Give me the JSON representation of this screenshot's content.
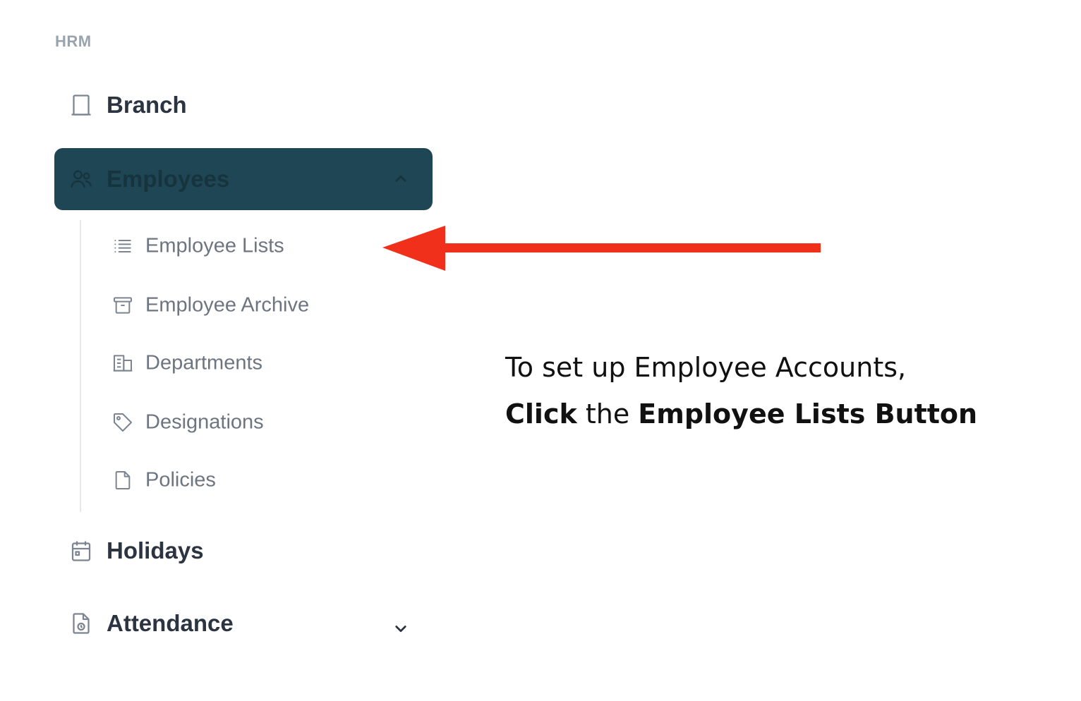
{
  "sidebar": {
    "section_label": "HRM",
    "items": [
      {
        "label": "Branch",
        "icon": "building-icon"
      },
      {
        "label": "Employees",
        "icon": "users-icon",
        "expanded": true
      },
      {
        "label": "Holidays",
        "icon": "calendar-icon"
      },
      {
        "label": "Attendance",
        "icon": "file-clock-icon",
        "expanded": false
      }
    ],
    "employees_submenu": [
      {
        "label": "Employee Lists",
        "icon": "list-icon"
      },
      {
        "label": "Employee Archive",
        "icon": "archive-icon"
      },
      {
        "label": "Departments",
        "icon": "buildings-icon"
      },
      {
        "label": "Designations",
        "icon": "tag-icon"
      },
      {
        "label": "Policies",
        "icon": "document-icon"
      }
    ]
  },
  "annotation": {
    "line1": "To set up Employee Accounts,",
    "line2_bold1": "Click",
    "line2_mid": " the ",
    "line2_bold2": "Employee Lists Button"
  },
  "colors": {
    "active_bg": "#1f4654",
    "arrow": "#f0301a",
    "muted_text": "#6c7580",
    "primary_text": "#2b3440"
  }
}
